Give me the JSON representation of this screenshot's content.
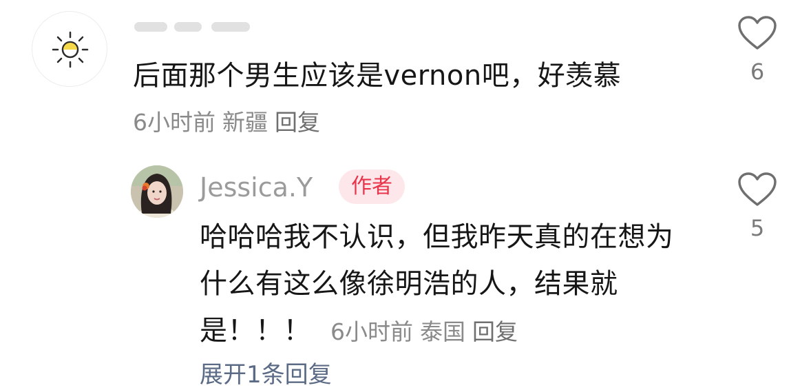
{
  "comments": [
    {
      "username": "",
      "text": "后面那个男生应该是vernon吧，好羡慕",
      "time": "6小时前",
      "location": "新疆",
      "reply_label": "回复",
      "likes": "6",
      "avatar_icon": "sun-icon"
    },
    {
      "username": "Jessica.Y",
      "badge": "作者",
      "text_lines": [
        "哈哈哈我不认识，但我昨天真的在想为",
        "什么有这么像徐明浩的人，结果就",
        "是！！！"
      ],
      "time": "6小时前",
      "location": "泰国",
      "reply_label": "回复",
      "likes": "5",
      "avatar_icon": "profile-photo"
    }
  ],
  "expand_replies": "展开1条回复",
  "colors": {
    "badge_bg": "#fde7ea",
    "badge_text": "#e8354c",
    "meta_text": "#8a8a8a",
    "link": "#5b6b86"
  }
}
